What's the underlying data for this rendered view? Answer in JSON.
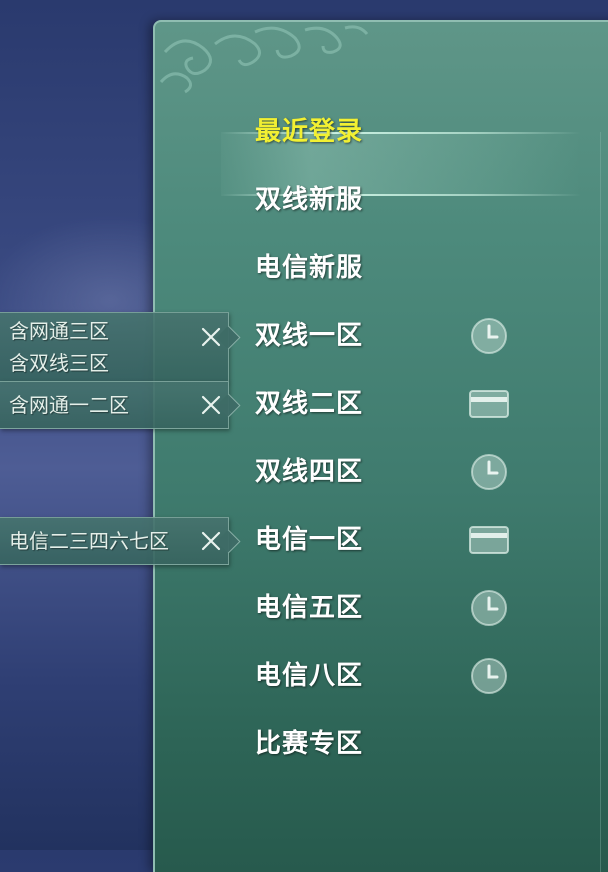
{
  "servers": [
    {
      "label": "最近登录",
      "selected": true,
      "status": null
    },
    {
      "label": "双线新服",
      "selected": false,
      "status": null
    },
    {
      "label": "电信新服",
      "selected": false,
      "status": null
    },
    {
      "label": "双线一区",
      "selected": false,
      "status": "clock-icon"
    },
    {
      "label": "双线二区",
      "selected": false,
      "status": "card-icon"
    },
    {
      "label": "双线四区",
      "selected": false,
      "status": "clock-icon"
    },
    {
      "label": "电信一区",
      "selected": false,
      "status": "card-icon"
    },
    {
      "label": "电信五区",
      "selected": false,
      "status": "clock-icon"
    },
    {
      "label": "电信八区",
      "selected": false,
      "status": "clock-icon"
    },
    {
      "label": "比赛专区",
      "selected": false,
      "status": null
    }
  ],
  "tooltips": [
    {
      "for": "双线一区",
      "lines": [
        "含网通三区",
        "含双线三区"
      ]
    },
    {
      "for": "双线二区",
      "lines": [
        "含网通一二区"
      ]
    },
    {
      "for": "电信一区",
      "lines": [
        "电信二三四六七区"
      ]
    }
  ],
  "colors": {
    "selected_text": "#f2f032",
    "normal_text": "#ffffff",
    "panel": "#4d8a7c",
    "background": "#3a4a82"
  }
}
